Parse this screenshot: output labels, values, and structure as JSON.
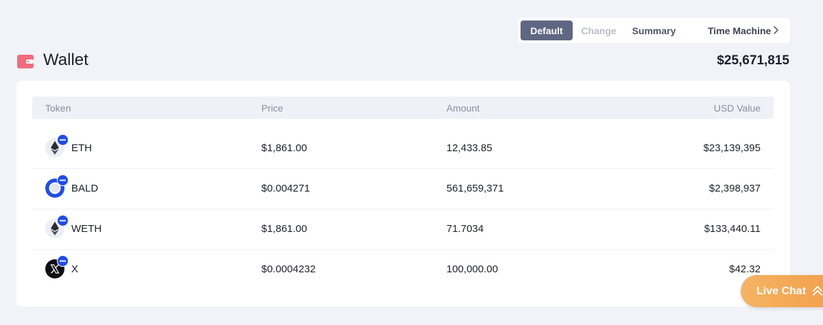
{
  "view_toggle": {
    "default_label": "Default",
    "change_label": "Change",
    "summary_label": "Summary"
  },
  "time_machine": {
    "label": "Time Machine",
    "icon": "chevron-right-icon"
  },
  "wallet": {
    "title": "Wallet",
    "total": "$25,671,815",
    "icon": "wallet-icon",
    "icon_color": "#f06b7d"
  },
  "table": {
    "headers": {
      "token": "Token",
      "price": "Price",
      "amount": "Amount",
      "usd_value": "USD Value"
    },
    "rows": [
      {
        "token": "ETH",
        "icon": "ethereum-icon",
        "price": "$1,861.00",
        "amount": "12,433.85",
        "usd_value": "$23,139,395"
      },
      {
        "token": "BALD",
        "icon": "bald-token-icon",
        "price": "$0.004271",
        "amount": "561,659,371",
        "usd_value": "$2,398,937"
      },
      {
        "token": "WETH",
        "icon": "ethereum-icon",
        "price": "$1,861.00",
        "amount": "71.7034",
        "usd_value": "$133,440.11"
      },
      {
        "token": "X",
        "icon": "x-token-icon",
        "price": "$0.0004232",
        "amount": "100,000.00",
        "usd_value": "$42.32"
      }
    ]
  },
  "live_chat": {
    "label": "Live Chat",
    "icon": "double-chevron-up-icon"
  },
  "colors": {
    "accent": "#5f6882",
    "badge_blue": "#1f4cf0",
    "live_chat_orange": "#f2a552"
  }
}
